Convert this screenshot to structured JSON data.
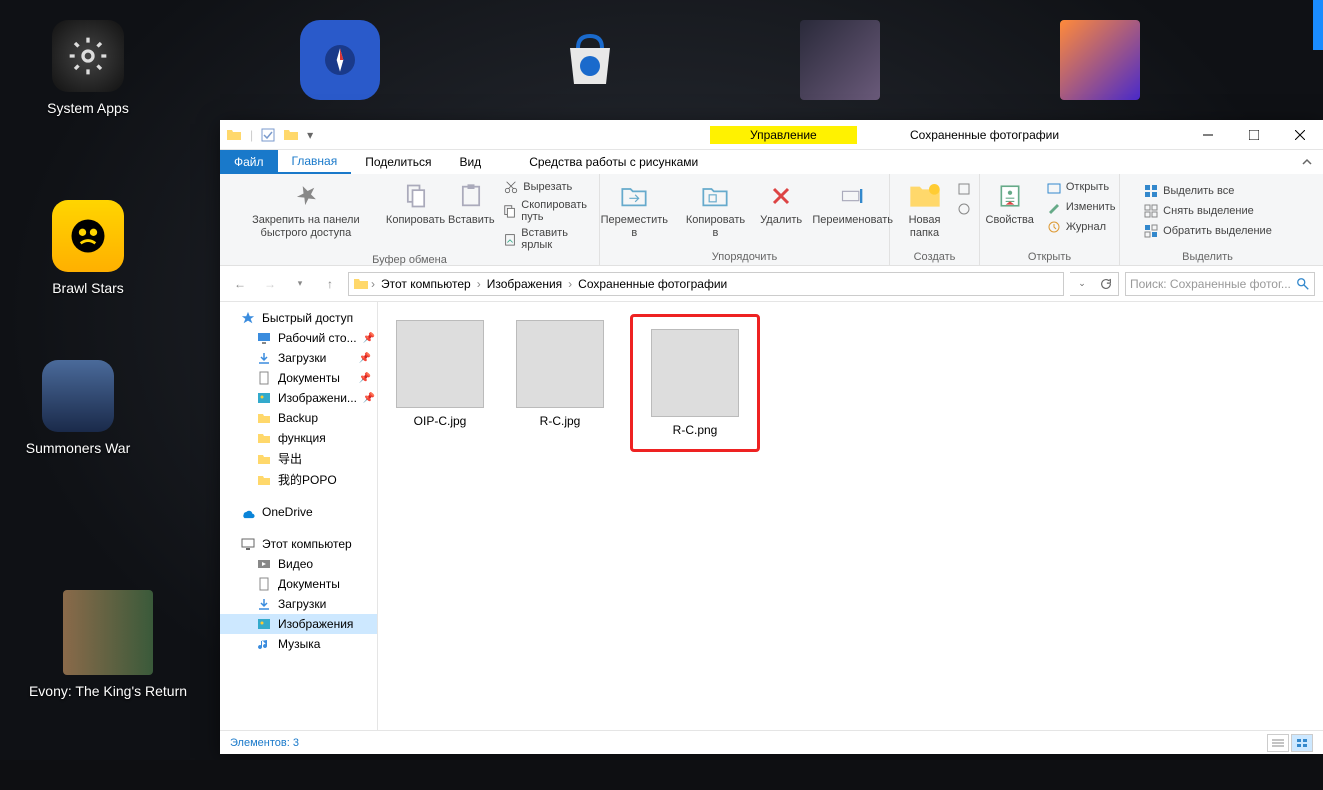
{
  "desktop_icons": {
    "system_apps": "System Apps",
    "brawl_stars": "Brawl Stars",
    "summoners_war": "Summoners War",
    "evony": "Evony: The King's Return"
  },
  "explorer": {
    "qat_context_label": "Управление",
    "window_title": "Сохраненные фотографии",
    "tabs": {
      "file": "Файл",
      "home": "Главная",
      "share": "Поделиться",
      "view": "Вид",
      "pictures_tools": "Средства работы с рисунками"
    },
    "ribbon": {
      "pin": "Закрепить на панели быстрого доступа",
      "copy": "Копировать",
      "paste": "Вставить",
      "cut": "Вырезать",
      "copy_path": "Скопировать путь",
      "paste_shortcut": "Вставить ярлык",
      "clipboard_group": "Буфер обмена",
      "move_to": "Переместить в",
      "copy_to": "Копировать в",
      "delete": "Удалить",
      "rename": "Переименовать",
      "organize_group": "Упорядочить",
      "new_folder": "Новая папка",
      "new_group": "Создать",
      "properties": "Свойства",
      "open": "Открыть",
      "edit": "Изменить",
      "history": "Журнал",
      "open_group": "Открыть",
      "select_all": "Выделить все",
      "select_none": "Снять выделение",
      "invert_selection": "Обратить выделение",
      "select_group": "Выделить"
    },
    "breadcrumbs": [
      "Этот компьютер",
      "Изображения",
      "Сохраненные фотографии"
    ],
    "search_placeholder": "Поиск: Сохраненные фотог...",
    "sidebar": {
      "quick_access": "Быстрый доступ",
      "desktop": "Рабочий сто...",
      "downloads": "Загрузки",
      "documents": "Документы",
      "pictures": "Изображени...",
      "backup": "Backup",
      "function": "функция",
      "export": "导出",
      "mypopo": "我的POPO",
      "onedrive": "OneDrive",
      "this_pc": "Этот компьютер",
      "videos": "Видео",
      "documents2": "Документы",
      "downloads2": "Загрузки",
      "pictures2": "Изображения",
      "music": "Музыка"
    },
    "files": [
      {
        "name": "OIP-C.jpg"
      },
      {
        "name": "R-C.jpg"
      },
      {
        "name": "R-C.png"
      }
    ],
    "status": "Элементов: 3"
  }
}
